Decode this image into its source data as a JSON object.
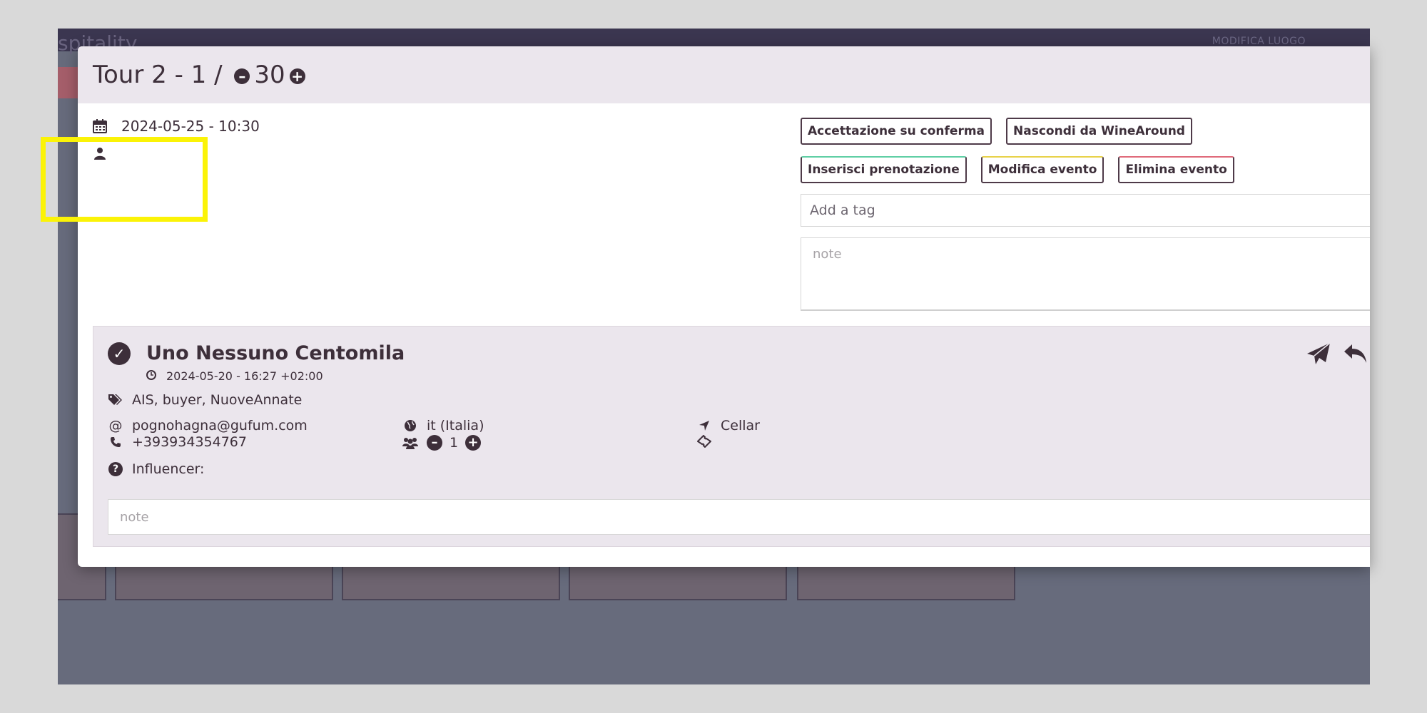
{
  "background": {
    "brand": "spitality",
    "action": "MODIFICA LUOGO"
  },
  "modal": {
    "title_prefix": "Tour 2 - 1 / ",
    "capacity": "30",
    "date_time": "2024-05-25 - 10:30",
    "guide": ""
  },
  "actions": {
    "accept_on_confirm": "Accettazione su conferma",
    "hide_wineround": "Nascondi da WineAround",
    "insert_booking": "Inserisci prenotazione",
    "edit_event": "Modifica evento",
    "delete_event": "Elimina evento"
  },
  "tag_input": {
    "placeholder": "Add a tag"
  },
  "event_note": {
    "placeholder": "note"
  },
  "booking": {
    "name": "Uno Nessuno Centomila",
    "created": "2024-05-20 - 16:27 +02:00",
    "tags": "AIS, buyer, NuoveAnnate",
    "email": "pognohagna@gufum.com",
    "phone": "+393934354767",
    "language": "it  (Italia)",
    "guests": "1",
    "location": "Cellar",
    "ticket": "",
    "influencer_label": "Influencer:",
    "note_placeholder": "note"
  },
  "colors": {
    "primary": "#3d2f3a",
    "header_bg": "#ebe6ed",
    "highlight": "#fbf307",
    "accent_green": "#5fcfa5",
    "accent_yellow": "#e8d24a",
    "accent_red": "#e06a7a"
  }
}
